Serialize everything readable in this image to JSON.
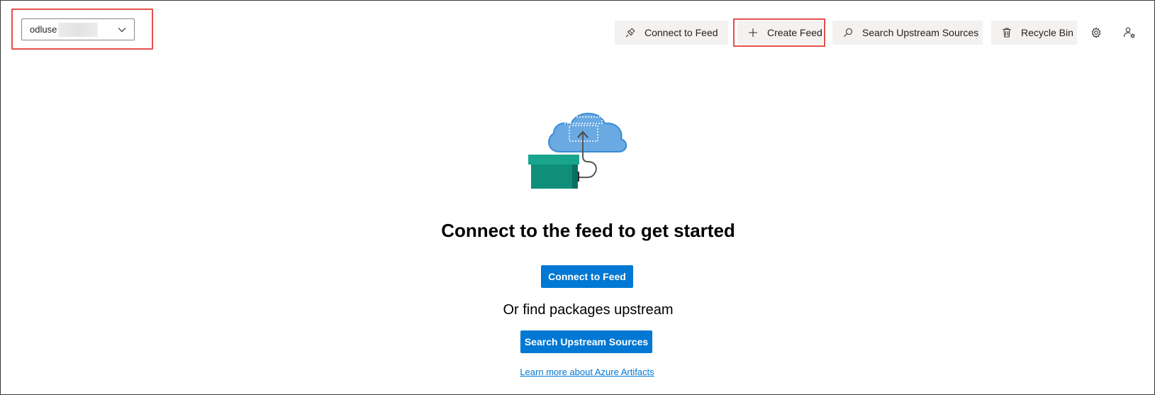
{
  "feed_selector": {
    "value": "odluse",
    "chevron_icon": "chevron-down-icon"
  },
  "toolbar": {
    "connect_label": "Connect to Feed",
    "create_label": "Create Feed",
    "search_label": "Search Upstream Sources",
    "recycle_label": "Recycle Bin",
    "settings_icon": "gear-icon",
    "permissions_icon": "people-settings-icon"
  },
  "empty_state": {
    "title": "Connect to the feed to get started",
    "connect_button": "Connect to Feed",
    "upstream_text": "Or find packages upstream",
    "search_button": "Search Upstream Sources",
    "learn_link": "Learn more about Azure Artifacts"
  },
  "colors": {
    "accent": "#0078d4",
    "highlight": "#e5514d",
    "button_bg": "#f3f2f1"
  }
}
